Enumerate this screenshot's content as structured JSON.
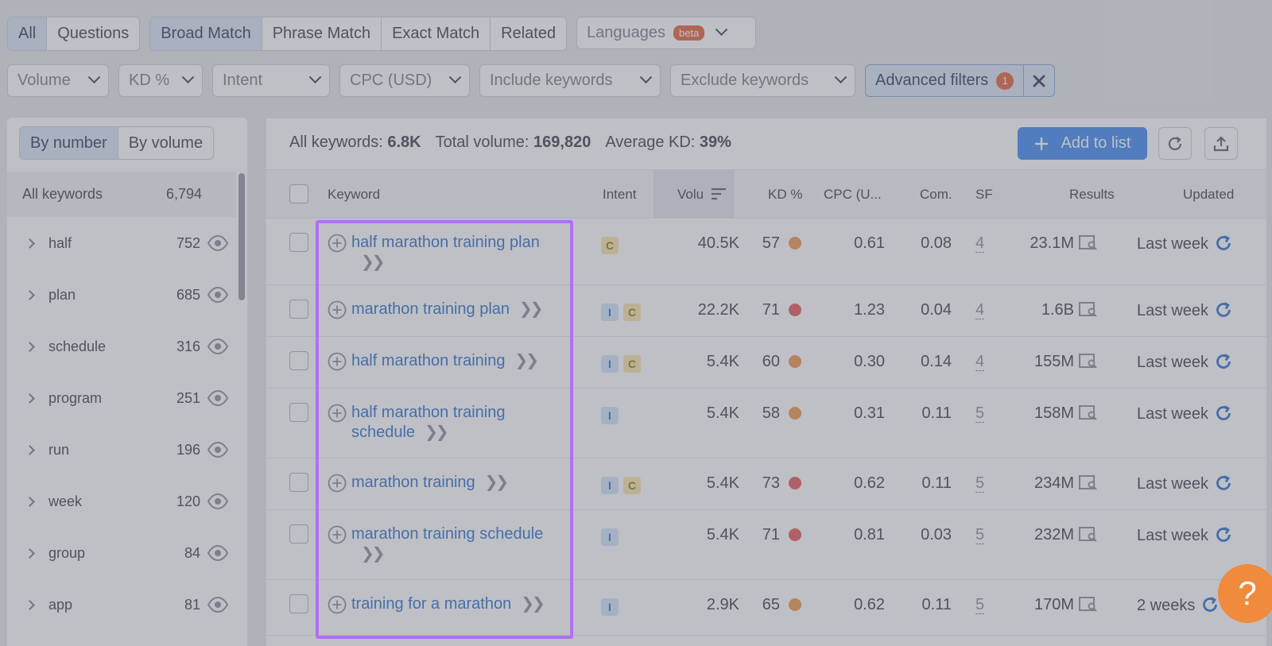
{
  "filters_row1": {
    "scope_tabs": [
      "All",
      "Questions"
    ],
    "match_tabs": [
      "Broad Match",
      "Phrase Match",
      "Exact Match",
      "Related"
    ],
    "languages_label": "Languages",
    "languages_badge": "beta"
  },
  "filters_row2": {
    "volume": "Volume",
    "kd": "KD %",
    "intent": "Intent",
    "cpc": "CPC (USD)",
    "include": "Include keywords",
    "exclude": "Exclude keywords",
    "advanced_label": "Advanced filters",
    "advanced_count": "1"
  },
  "left_panel": {
    "tabs": [
      "By number",
      "By volume"
    ],
    "all_label": "All keywords",
    "all_count": "6,794",
    "groups": [
      {
        "label": "half",
        "count": "752"
      },
      {
        "label": "plan",
        "count": "685"
      },
      {
        "label": "schedule",
        "count": "316"
      },
      {
        "label": "program",
        "count": "251"
      },
      {
        "label": "run",
        "count": "196"
      },
      {
        "label": "week",
        "count": "120"
      },
      {
        "label": "group",
        "count": "84"
      },
      {
        "label": "app",
        "count": "81"
      }
    ]
  },
  "summary": {
    "all_label": "All keywords:",
    "all_value": "6.8K",
    "volume_label": "Total volume:",
    "volume_value": "169,820",
    "kd_label": "Average KD:",
    "kd_value": "39%",
    "add_label": "Add to list"
  },
  "columns": {
    "keyword": "Keyword",
    "intent": "Intent",
    "volume": "Volu",
    "kd": "KD %",
    "cpc": "CPC (U...",
    "com": "Com.",
    "sf": "SF",
    "results": "Results",
    "updated": "Updated"
  },
  "rows": [
    {
      "kw1": "half marathon training plan",
      "kw2": "",
      "intents": [
        "C"
      ],
      "volume": "40.5K",
      "kd": "57",
      "kd_color": "#f08a3c",
      "cpc": "0.61",
      "com": "0.08",
      "sf": "4",
      "results": "23.1M",
      "updated": "Last week"
    },
    {
      "kw1": "marathon training plan",
      "kw2": "",
      "intents": [
        "I",
        "C"
      ],
      "volume": "22.2K",
      "kd": "71",
      "kd_color": "#e5484d",
      "cpc": "1.23",
      "com": "0.04",
      "sf": "4",
      "results": "1.6B",
      "updated": "Last week"
    },
    {
      "kw1": "half marathon training",
      "kw2": "",
      "intents": [
        "I",
        "C"
      ],
      "volume": "5.4K",
      "kd": "60",
      "kd_color": "#f08a3c",
      "cpc": "0.30",
      "com": "0.14",
      "sf": "4",
      "results": "155M",
      "updated": "Last week"
    },
    {
      "kw1": "half marathon training",
      "kw2": "schedule",
      "intents": [
        "I"
      ],
      "volume": "5.4K",
      "kd": "58",
      "kd_color": "#f08a3c",
      "cpc": "0.31",
      "com": "0.11",
      "sf": "5",
      "results": "158M",
      "updated": "Last week"
    },
    {
      "kw1": "marathon training",
      "kw2": "",
      "intents": [
        "I",
        "C"
      ],
      "volume": "5.4K",
      "kd": "73",
      "kd_color": "#e5484d",
      "cpc": "0.62",
      "com": "0.11",
      "sf": "5",
      "results": "234M",
      "updated": "Last week"
    },
    {
      "kw1": "marathon training schedule",
      "kw2": "",
      "intents": [
        "I"
      ],
      "volume": "5.4K",
      "kd": "71",
      "kd_color": "#e5484d",
      "cpc": "0.81",
      "com": "0.03",
      "sf": "5",
      "results": "232M",
      "updated": "Last week"
    },
    {
      "kw1": "training for a marathon",
      "kw2": "",
      "intents": [
        "I"
      ],
      "volume": "2.9K",
      "kd": "65",
      "kd_color": "#f08a3c",
      "cpc": "0.62",
      "com": "0.11",
      "sf": "5",
      "results": "170M",
      "updated": "2 weeks"
    }
  ],
  "help_label": "?"
}
